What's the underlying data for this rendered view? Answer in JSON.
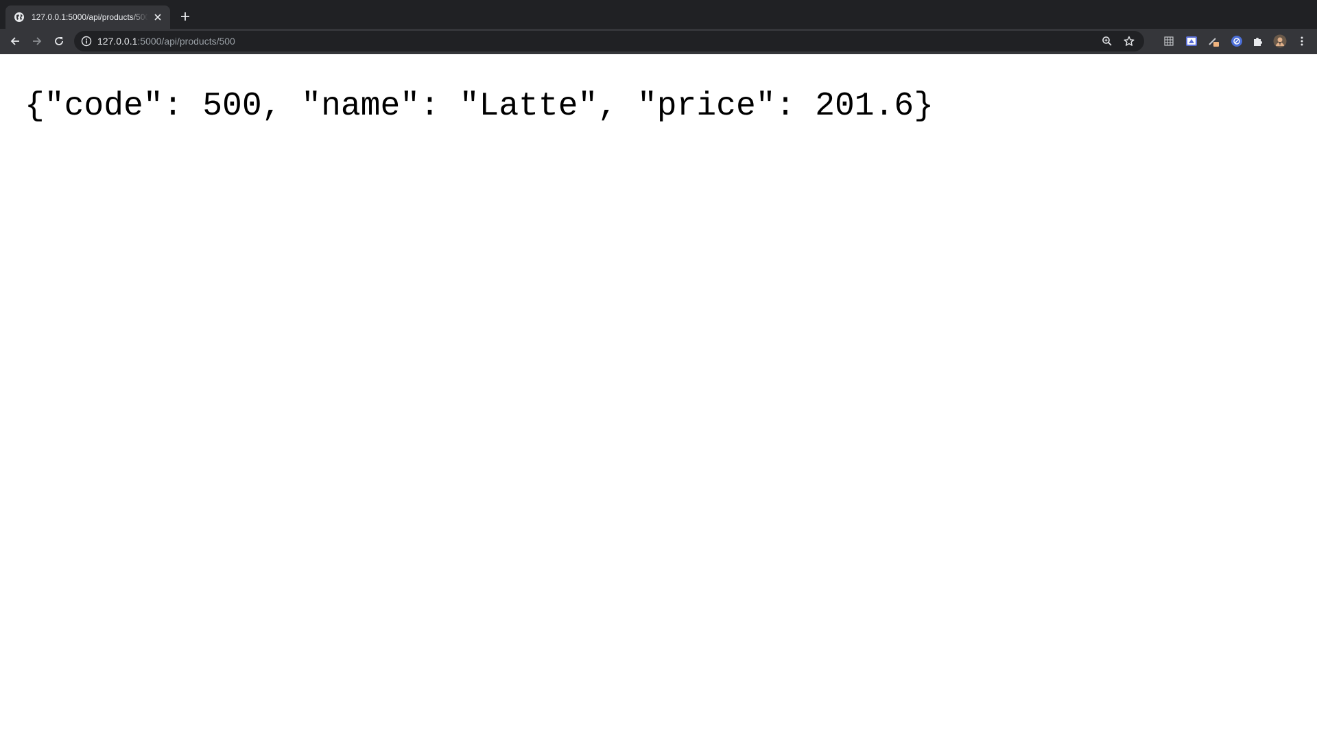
{
  "tab": {
    "title": "127.0.0.1:5000/api/products/500",
    "favicon": "globe-icon",
    "close": "close-icon"
  },
  "toolbar": {
    "back": "back-arrow-icon",
    "forward": "forward-arrow-icon",
    "reload": "reload-icon",
    "new_tab": "plus-icon"
  },
  "address_bar": {
    "host": "127.0.0.1",
    "path": ":5000/api/products/500",
    "security_icon": "info-icon",
    "zoom_icon": "zoom-icon",
    "bookmark_icon": "star-icon"
  },
  "extensions": [
    "grid-icon",
    "screen-capture-icon",
    "pencil-icon",
    "blocker-icon",
    "puzzle-icon",
    "avatar-icon",
    "kebab-menu-icon"
  ],
  "page": {
    "body_text": "{\"code\": 500, \"name\": \"Latte\", \"price\": 201.6}"
  },
  "colors": {
    "tabstrip": "#202124",
    "toolbar": "#35363a",
    "omnibox": "#202124",
    "page_background": "#ffffff",
    "text": "#000000"
  }
}
